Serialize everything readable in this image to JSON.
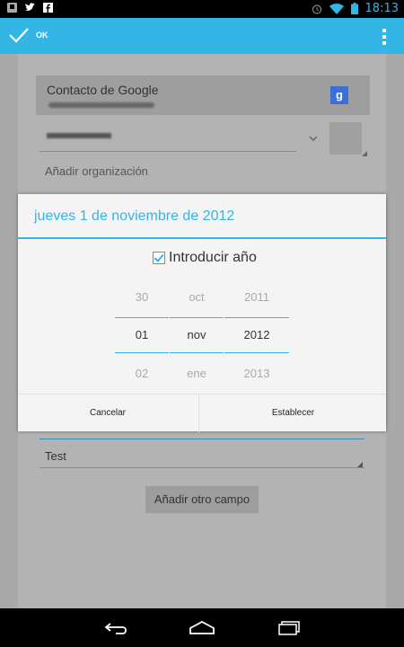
{
  "status_bar": {
    "time": "18:13",
    "left_icons": [
      "notification-icon",
      "twitter-icon",
      "facebook-icon"
    ],
    "right_icons": [
      "alarm-icon",
      "wifi-icon",
      "battery-icon"
    ]
  },
  "action_bar": {
    "ok_label": "OK",
    "ok_icon": "check-icon",
    "overflow_icon": "overflow-menu-icon",
    "accent": "#33b5e5"
  },
  "form": {
    "account_title": "Contacto de Google",
    "add_org_label": "Añadir organización",
    "custom_field_value": "Test",
    "add_field_button": "Añadir otro campo"
  },
  "dialog": {
    "title": "jueves 1 de noviembre de 2012",
    "year_toggle_label": "Introducir año",
    "year_toggle_checked": true,
    "day": {
      "prev": "30",
      "current": "01",
      "next": "02"
    },
    "month": {
      "prev": "oct",
      "current": "nov",
      "next": "ene"
    },
    "year": {
      "prev": "2011",
      "current": "2012",
      "next": "2013"
    },
    "cancel_label": "Cancelar",
    "set_label": "Establecer"
  },
  "nav_bar": {
    "icons": [
      "back-icon",
      "home-icon",
      "recent-apps-icon"
    ]
  }
}
